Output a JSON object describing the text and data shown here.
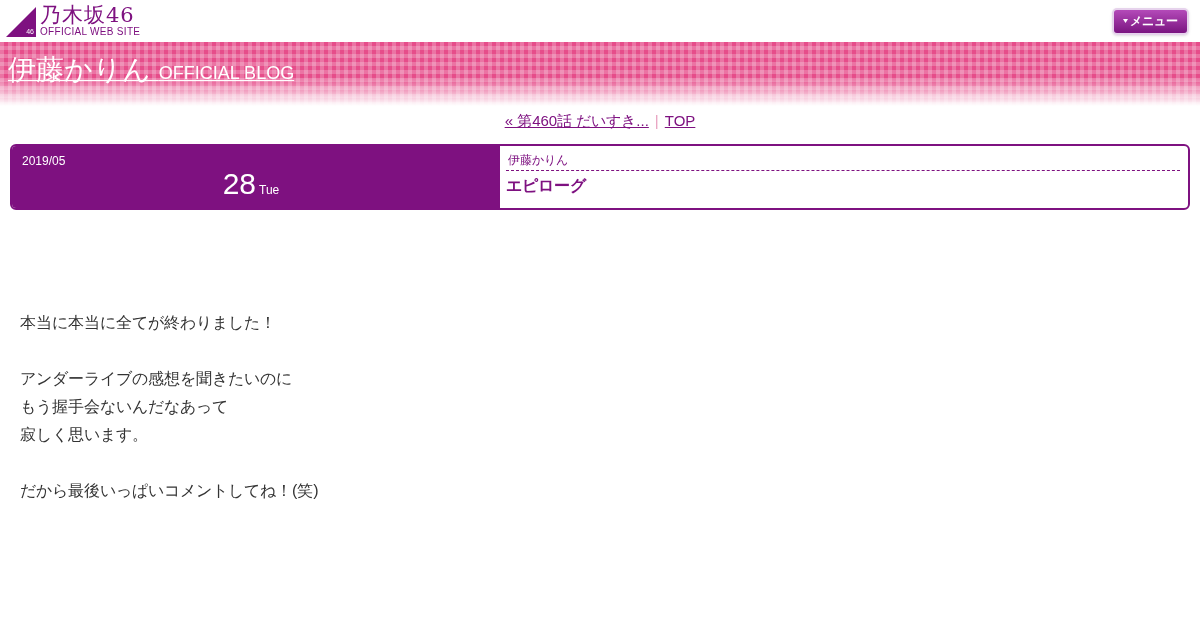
{
  "header": {
    "logo": {
      "mark": "46",
      "name": "乃木坂46",
      "subtitle": "OFFICIAL WEB SITE"
    },
    "menu_button": {
      "label": "メニュー"
    }
  },
  "banner": {
    "member": "伊藤かりん ",
    "blog": "OFFICIAL BLOG"
  },
  "nav": {
    "previous": "« 第460話 だいすき...",
    "separator": "|",
    "top": "TOP"
  },
  "entry": {
    "year_month": "2019/05",
    "day": "28",
    "weekday": "Tue",
    "author": "伊藤かりん",
    "title": "エピローグ"
  },
  "body": {
    "paragraphs": [
      [
        "本当に本当に全てが終わりました！"
      ],
      [
        "アンダーライブの感想を聞きたいのに",
        "もう握手会ないんだなあって",
        "寂しく思います。"
      ],
      [
        "だから最後いっぱいコメントしてね！(笑)"
      ]
    ]
  }
}
